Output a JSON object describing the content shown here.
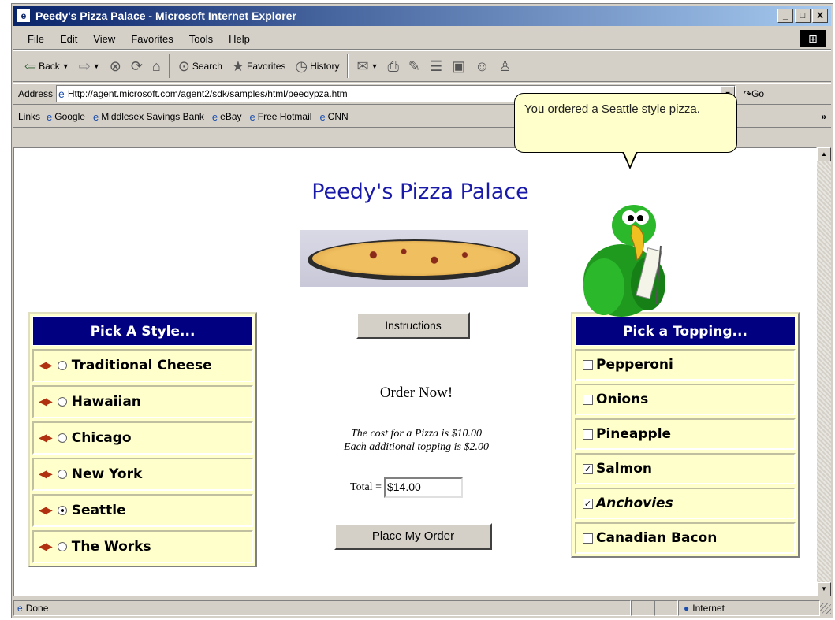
{
  "window": {
    "title": "Peedy's Pizza Palace - Microsoft Internet Explorer",
    "minimize": "_",
    "maximize": "□",
    "close": "X"
  },
  "menubar": {
    "items": [
      "File",
      "Edit",
      "View",
      "Favorites",
      "Tools",
      "Help"
    ]
  },
  "toolbar": {
    "back": "Back",
    "search": "Search",
    "favorites": "Favorites",
    "history": "History"
  },
  "address": {
    "label": "Address",
    "url": "Http://agent.microsoft.com/agent2/sdk/samples/html/peedypza.htm",
    "go": "Go"
  },
  "links": {
    "label": "Links",
    "items": [
      "Google",
      "Middlesex Savings Bank",
      "eBay",
      "Free Hotmail",
      "CNN"
    ]
  },
  "page": {
    "title": "Peedy's Pizza Palace",
    "instructions_label": "Instructions",
    "order_heading": "Order Now!",
    "cost_line_1": "The cost for a Pizza is $10.00",
    "cost_line_2": "Each additional topping is $2.00",
    "total_label": "Total =",
    "total_value": "$14.00",
    "place_order_label": "Place My Order"
  },
  "styles": {
    "header": "Pick A Style...",
    "selected": "Seattle",
    "options": [
      "Traditional Cheese",
      "Hawaiian",
      "Chicago",
      "New York",
      "Seattle",
      "The Works"
    ]
  },
  "toppings": {
    "header": "Pick a Topping...",
    "options": [
      {
        "label": "Pepperoni",
        "checked": false
      },
      {
        "label": "Onions",
        "checked": false
      },
      {
        "label": "Pineapple",
        "checked": false
      },
      {
        "label": "Salmon",
        "checked": true
      },
      {
        "label": "Anchovies",
        "checked": true
      },
      {
        "label": "Canadian Bacon",
        "checked": false
      }
    ]
  },
  "agent": {
    "balloon_text": "You ordered a Seattle style pizza."
  },
  "status": {
    "text": "Done",
    "zone": "Internet"
  }
}
